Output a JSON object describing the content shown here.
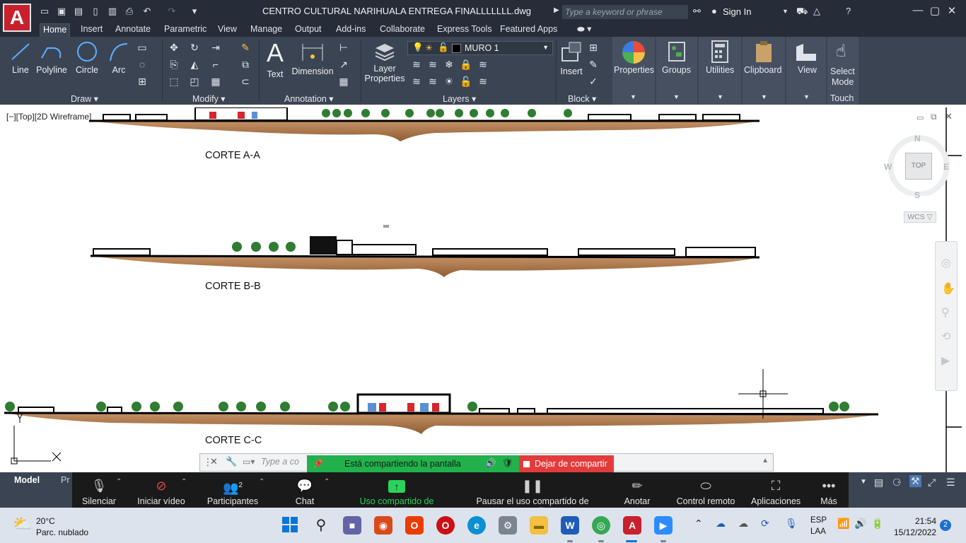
{
  "app": {
    "logo_letter": "A",
    "document_title": "CENTRO CULTURAL NARIHUALA ENTREGA FINALLLLLLL.dwg",
    "search_placeholder": "Type a keyword or phrase",
    "sign_in": "Sign In"
  },
  "ribbon_tabs": [
    "Home",
    "Insert",
    "Annotate",
    "Parametric",
    "View",
    "Manage",
    "Output",
    "Add-ins",
    "Collaborate",
    "Express Tools",
    "Featured Apps"
  ],
  "ribbon": {
    "draw": {
      "line": "Line",
      "polyline": "Polyline",
      "circle": "Circle",
      "arc": "Arc",
      "panel": "Draw"
    },
    "modify": {
      "panel": "Modify"
    },
    "annotation": {
      "text": "Text",
      "dimension": "Dimension",
      "panel": "Annotation"
    },
    "layers": {
      "layer_properties_1": "Layer",
      "layer_properties_2": "Properties",
      "current_layer": "MURO 1",
      "panel": "Layers"
    },
    "block": {
      "insert": "Insert",
      "panel": "Block"
    },
    "properties": "Properties",
    "groups": "Groups",
    "utilities": "Utilities",
    "clipboard": "Clipboard",
    "view": "View",
    "select_mode_1": "Select",
    "select_mode_2": "Mode",
    "touch": "Touch"
  },
  "drawing": {
    "viewport_label": "[−][Top][2D Wireframe]",
    "sections": [
      "CORTE A-A",
      "CORTE B-B",
      "CORTE C-C"
    ],
    "viewcube": {
      "n": "N",
      "s": "S",
      "e": "E",
      "w": "W",
      "top": "TOP"
    },
    "wcs": "WCS ▽",
    "command_placeholder": "Type a co"
  },
  "sharing": {
    "status": "Está compartiendo la pantalla",
    "stop": "Dejar de compartir"
  },
  "layout_tabs": {
    "model": "Model",
    "partial": "Pr"
  },
  "zoom_toolbar": {
    "mute": "Silenciar",
    "video": "Iniciar vídeo",
    "participants": "Participantes",
    "participants_count": "2",
    "chat": "Chat",
    "share": "Uso compartido de pantalla",
    "pause": "Pausar el uso compartido de pantalla",
    "annotate": "Anotar",
    "remote": "Control remoto",
    "apps": "Aplicaciones",
    "more": "Más"
  },
  "taskbar": {
    "temperature": "20°C",
    "weather": "Parc. nublado",
    "lang_1": "ESP",
    "lang_2": "LAA",
    "time": "21:54",
    "date": "15/12/2022",
    "notifications": "2"
  },
  "colors": {
    "chrome_dark": "#262d38",
    "ribbon": "#3b4453",
    "autocad_red": "#c8202c",
    "share_green": "#22b14c",
    "share_red": "#e33b3b",
    "terrain": "#a8774a"
  }
}
